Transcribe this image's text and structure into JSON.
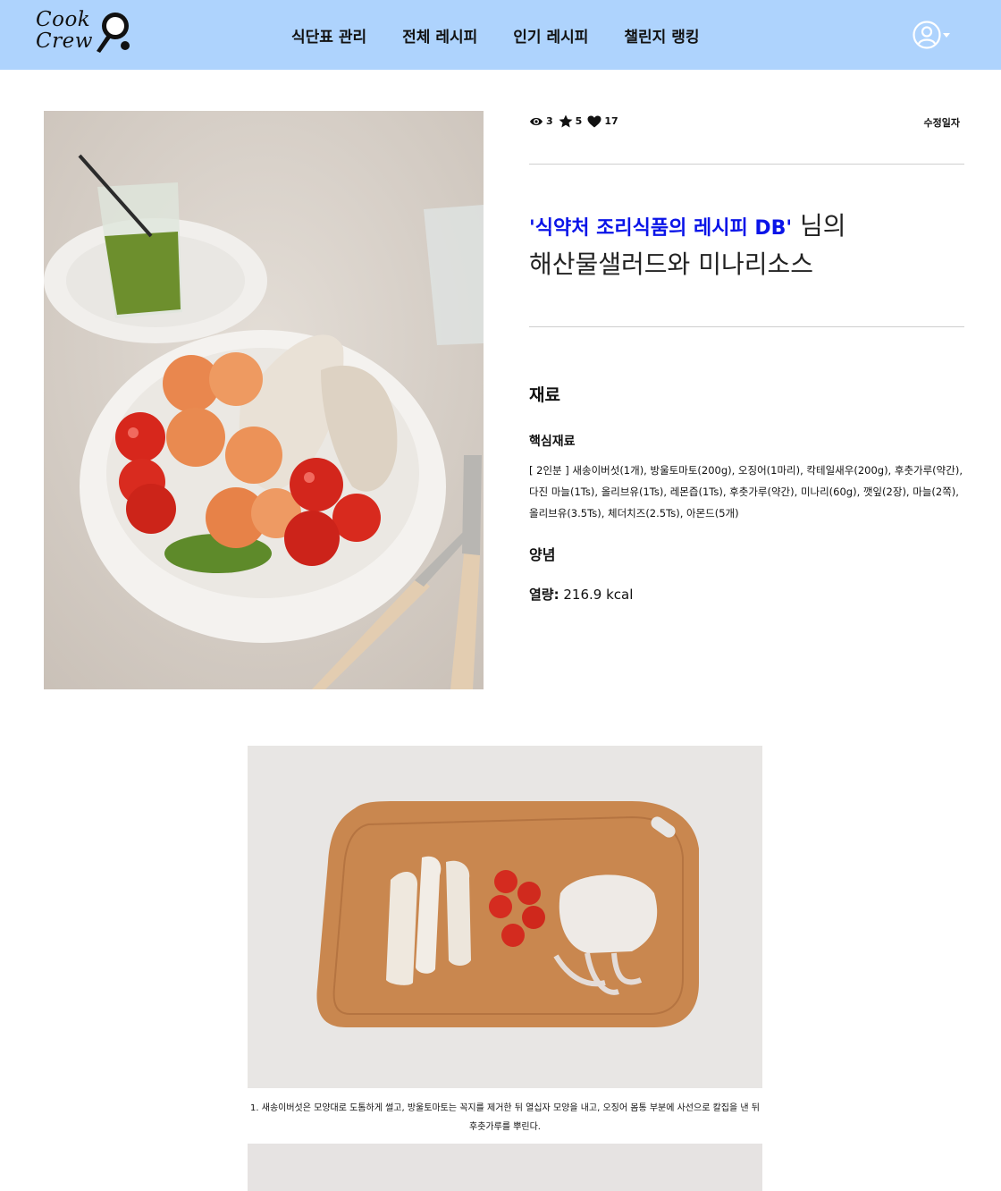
{
  "brand": {
    "line1": "Cook",
    "line2": "Crew"
  },
  "nav": {
    "items": [
      {
        "label": "식단표 관리"
      },
      {
        "label": "전체 레시피"
      },
      {
        "label": "인기 레시피"
      },
      {
        "label": "챌린지 랭킹"
      }
    ],
    "user_icon": "user-circle-icon"
  },
  "recipe": {
    "stats": {
      "views": "3",
      "stars": "5",
      "likes": "17"
    },
    "modified_label": "수정일자",
    "author": "'식약처 조리식품의 레시피 DB'",
    "author_suffix": " 님의",
    "title": "해산물샐러드와 미나리소스"
  },
  "ingredients": {
    "heading": "재료",
    "main_heading": "핵심재료",
    "main_text": "[ 2인분 ] 새송이버섯(1개), 방울토마토(200g), 오징어(1마리), 칵테일새우(200g), 후춧가루(약간), 다진 마늘(1Ts), 올리브유(1Ts), 레몬즙(1Ts), 후춧가루(약간), 미나리(60g), 깻잎(2장), 마늘(2쪽), 올리브유(3.5Ts), 체더치즈(2.5Ts), 아몬드(5개)",
    "sauce_heading": "양념",
    "calorie_label": "열량:",
    "calorie_value": " 216.9 kcal"
  },
  "steps": [
    {
      "text": "1. 새송이버섯은 모양대로 도톰하게 썰고, 방울토마토는 꼭지를 제거한 뒤 열십자 모양을 내고, 오징어 몸통 부분에 사선으로 칼집을 낸 뒤 후춧가루를 뿌린다."
    }
  ],
  "colors": {
    "header_bg": "#aed3fd",
    "author_blue": "#0a14e8",
    "divider": "#cfcfcf"
  },
  "icons": [
    "eye-icon",
    "star-icon",
    "heart-icon",
    "magnifier-icon",
    "user-circle-icon",
    "chevron-down-icon"
  ]
}
